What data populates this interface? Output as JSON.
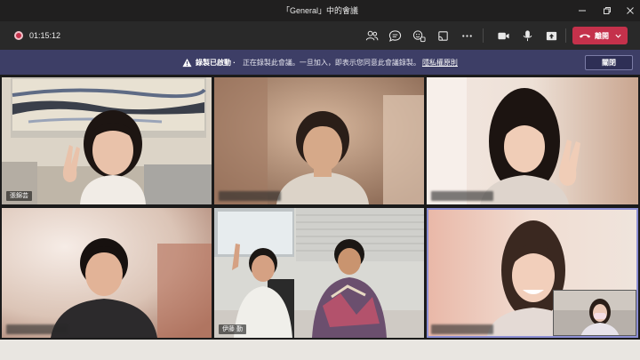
{
  "window": {
    "title": "「General」中的會議"
  },
  "toolbar": {
    "timer": "01:15:12",
    "leave_label": "離開",
    "icons": [
      "participants-icon",
      "chat-icon",
      "reactions-icon",
      "share-tray-icon",
      "more-icon",
      "camera-icon",
      "mic-icon",
      "share-icon"
    ]
  },
  "banner": {
    "bold_text": "錄製已啟動 ·",
    "message": "正在錄製此會議。一旦加入，即表示您同意此會議錄製。",
    "link_text": "隱私權原則",
    "dismiss_label": "關閉"
  },
  "participants": [
    {
      "name": "張錦芸",
      "name_visible": true
    },
    {
      "name": "",
      "name_visible": false
    },
    {
      "name": "",
      "name_visible": false
    },
    {
      "name": "",
      "name_visible": false
    },
    {
      "name": "伊藤 勤",
      "name_visible": true
    },
    {
      "name": "",
      "name_visible": false
    }
  ],
  "colors": {
    "accent": "#c4314b",
    "banner": "#3d3e66",
    "active_speaker": "#8d8fd4"
  }
}
